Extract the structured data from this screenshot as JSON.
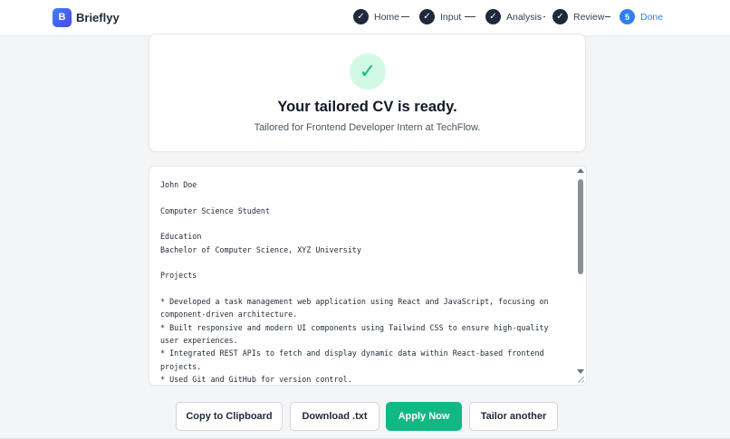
{
  "brand": {
    "logo_letter": "B",
    "name": "Brieflyy"
  },
  "stepper": {
    "steps": [
      {
        "label": "Home",
        "icon": "✓",
        "state": "complete"
      },
      {
        "label": "Input",
        "icon": "✓",
        "state": "complete"
      },
      {
        "label": "Analysis",
        "icon": "✓",
        "state": "complete"
      },
      {
        "label": "Review",
        "icon": "✓",
        "state": "complete"
      },
      {
        "label": "Done",
        "icon": "5",
        "state": "current"
      }
    ]
  },
  "success": {
    "icon": "check-icon",
    "glyph": "✓",
    "title": "Your tailored CV is ready.",
    "subtitle": "Tailored for Frontend Developer Intern at TechFlow."
  },
  "cv": {
    "text": "John Doe\n\nComputer Science Student\n\nEducation\nBachelor of Computer Science, XYZ University\n\nProjects\n\n* Developed a task management web application using React and JavaScript, focusing on component-driven architecture.\n* Built responsive and modern UI components using Tailwind CSS to ensure high-quality user experiences.\n* Integrated REST APIs to fetch and display dynamic data within React-based frontend projects.\n* Used Git and GitHub for version control."
  },
  "actions": {
    "copy_label": "Copy to Clipboard",
    "download_label": "Download .txt",
    "apply_label": "Apply Now",
    "tailor_label": "Tailor another"
  },
  "colors": {
    "accent": "#2f80ed",
    "success": "#10b981",
    "success_bg": "#d1fae5",
    "step_complete": "#1e293b",
    "brand_gradient_start": "#3b82f6",
    "brand_gradient_end": "#4f46e5"
  }
}
